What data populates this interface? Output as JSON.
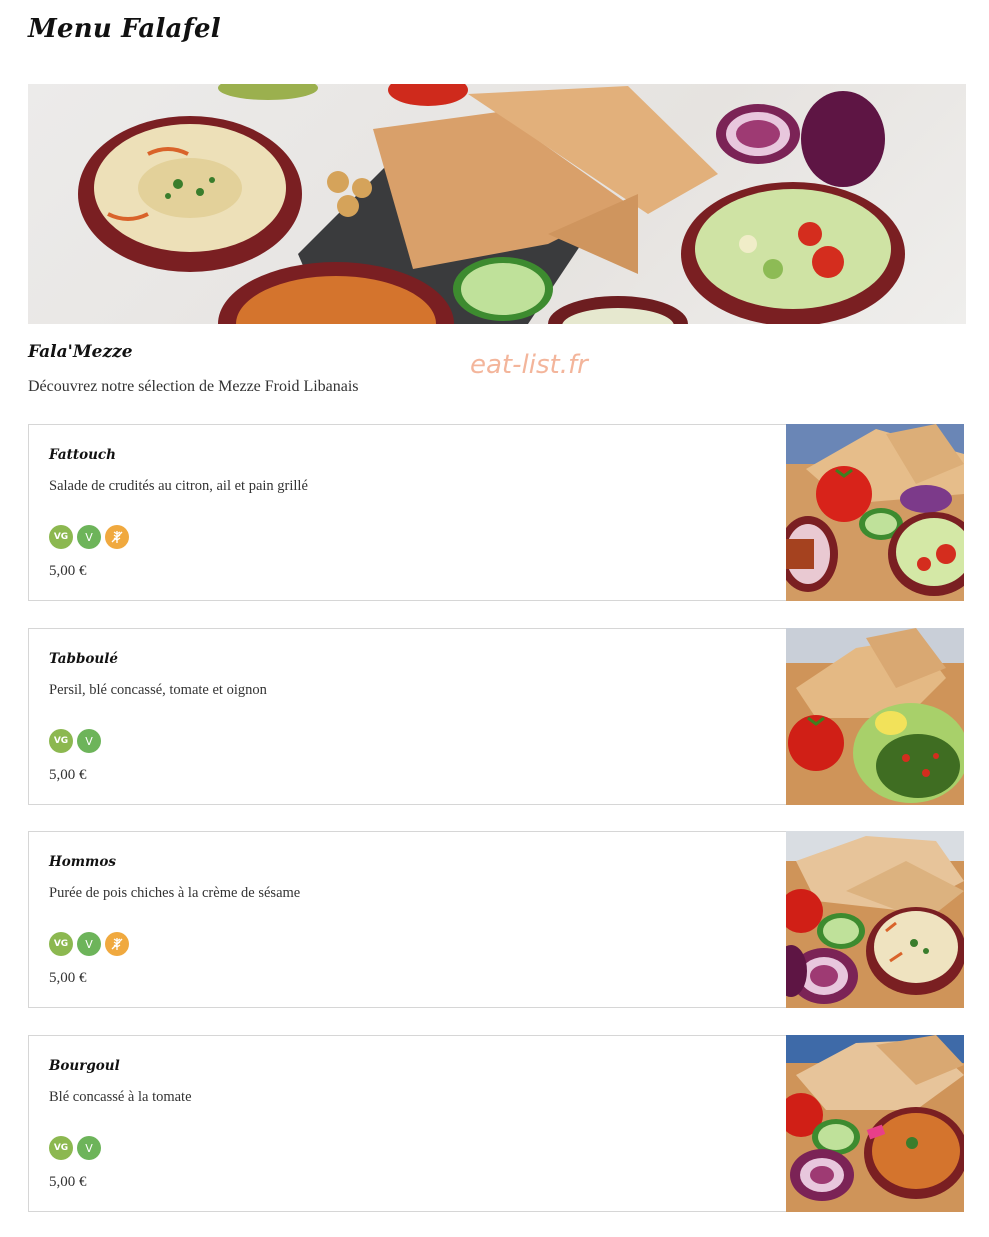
{
  "page": {
    "title": "Menu Falafel"
  },
  "watermark": "eat-list.fr",
  "section": {
    "title": "Fala'Mezze",
    "description": "Découvrez notre sélection de Mezze Froid Libanais"
  },
  "badge_labels": {
    "vegan": "VG",
    "vegetarian": "V"
  },
  "colors": {
    "vegan": "#8cb850",
    "vegetarian": "#6db45a",
    "gluten_free": "#f0a93f",
    "watermark": "#f2a98a"
  },
  "items": [
    {
      "name": "Fattouch",
      "description": "Salade de crudités au citron, ail et pain grillé",
      "price": "5,00 €",
      "tags": [
        "vegan",
        "vegetarian",
        "gluten-free"
      ]
    },
    {
      "name": "Tabboulé",
      "description": "Persil, blé concassé, tomate et oignon",
      "price": "5,00 €",
      "tags": [
        "vegan",
        "vegetarian"
      ]
    },
    {
      "name": "Hommos",
      "description": "Purée de pois chiches à la crème de sésame",
      "price": "5,00 €",
      "tags": [
        "vegan",
        "vegetarian",
        "gluten-free"
      ]
    },
    {
      "name": "Bourgoul",
      "description": "Blé concassé à la tomate",
      "price": "5,00 €",
      "tags": [
        "vegan",
        "vegetarian"
      ]
    }
  ]
}
